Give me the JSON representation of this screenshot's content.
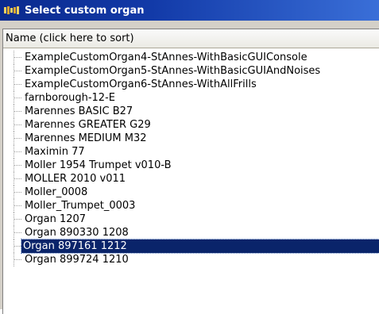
{
  "window": {
    "title": "Select custom organ",
    "icon": "organ-icon"
  },
  "list": {
    "column_header": "Name (click here to sort)",
    "items": [
      {
        "label": "ExampleCustomOrgan4-StAnnes-WithBasicGUIConsole",
        "selected": false
      },
      {
        "label": "ExampleCustomOrgan5-StAnnes-WithBasicGUIAndNoises",
        "selected": false
      },
      {
        "label": "ExampleCustomOrgan6-StAnnes-WithAllFrills",
        "selected": false
      },
      {
        "label": "farnborough-12-E",
        "selected": false
      },
      {
        "label": "Marennes BASIC B27",
        "selected": false
      },
      {
        "label": "Marennes GREATER G29",
        "selected": false
      },
      {
        "label": "Marennes MEDIUM M32",
        "selected": false
      },
      {
        "label": "Maximin 77",
        "selected": false
      },
      {
        "label": "Moller 1954 Trumpet v010-B",
        "selected": false
      },
      {
        "label": "MOLLER 2010 v011",
        "selected": false
      },
      {
        "label": "Moller_0008",
        "selected": false
      },
      {
        "label": "Moller_Trumpet_0003",
        "selected": false
      },
      {
        "label": "Organ 1207",
        "selected": false
      },
      {
        "label": "Organ 890330 1208",
        "selected": false
      },
      {
        "label": "Organ 897161 1212",
        "selected": true
      },
      {
        "label": "Organ 899724 1210",
        "selected": false
      }
    ]
  },
  "colors": {
    "titlebar": "#0b2a8e",
    "selection": "#0a246a"
  }
}
